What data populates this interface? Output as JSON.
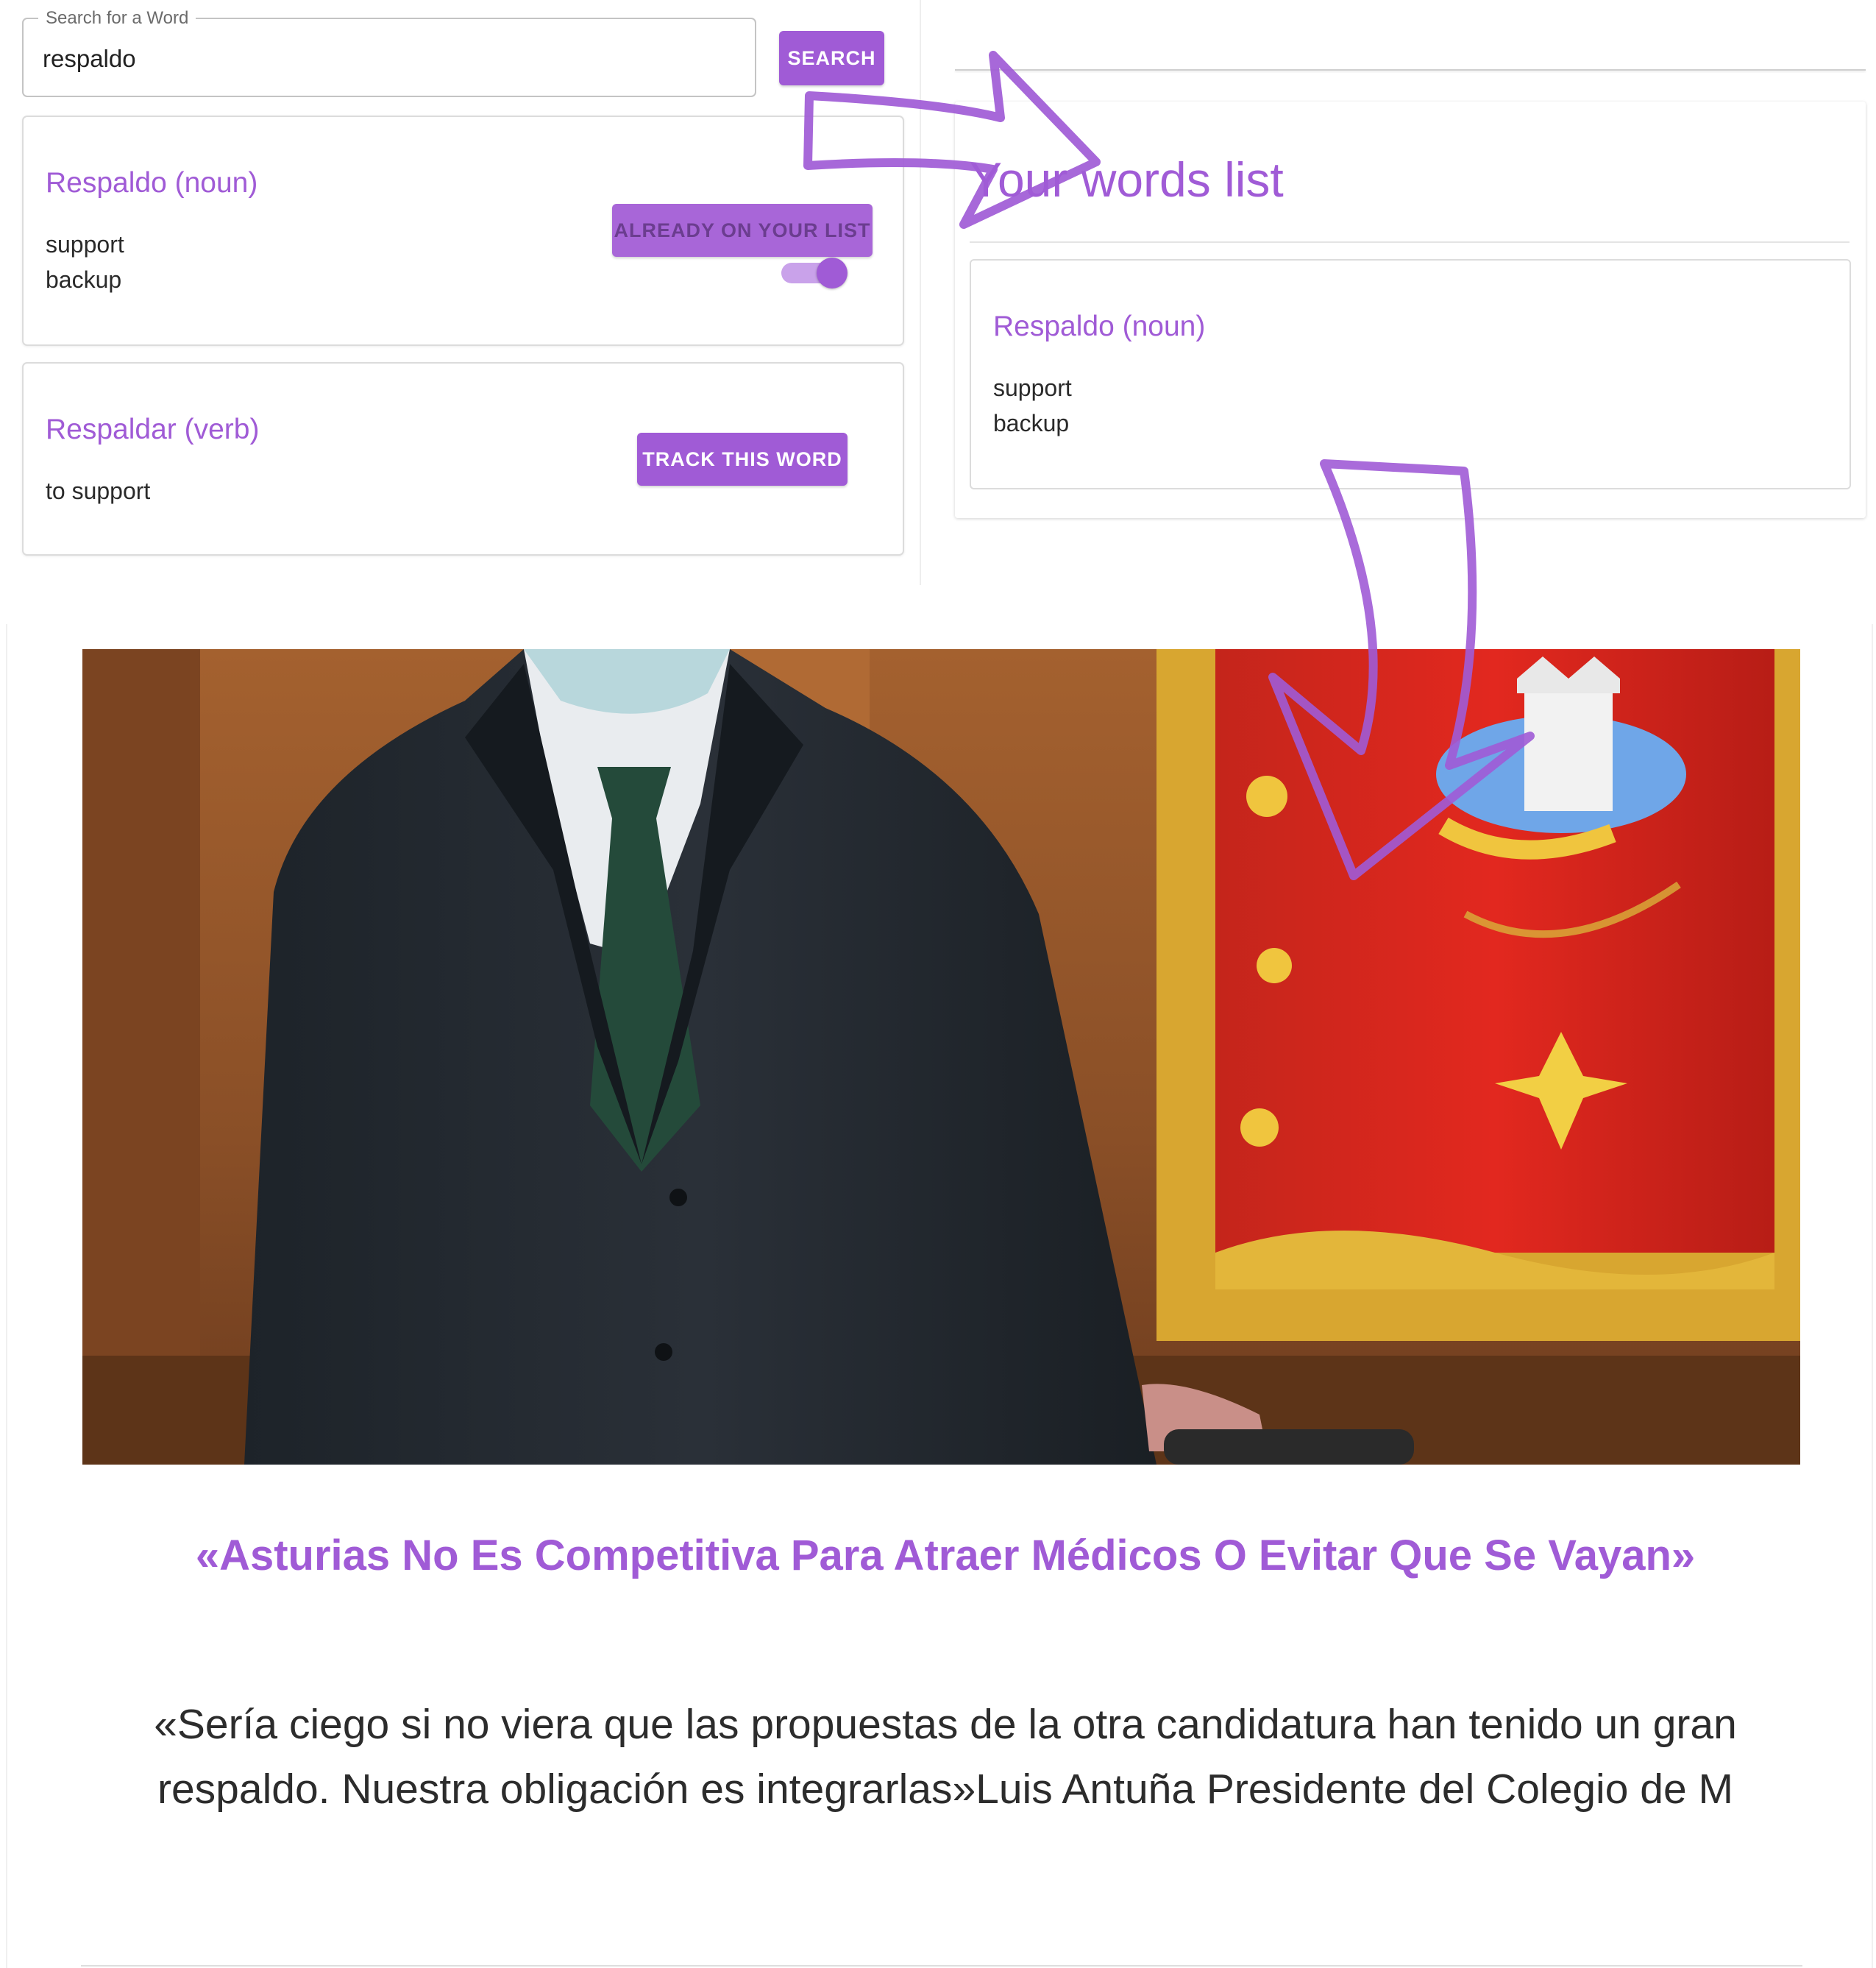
{
  "search": {
    "label": "Search for a Word",
    "value": "respaldo",
    "button_label": "SEARCH"
  },
  "results": [
    {
      "title": "Respaldo (noun)",
      "meanings": [
        "support",
        "backup"
      ],
      "action_label": "ALREADY ON YOUR LIST"
    },
    {
      "title": "Respaldar (verb)",
      "meanings": [
        "to support"
      ],
      "action_label": "TRACK THIS WORD"
    }
  ],
  "words_list": {
    "title": "Your words list",
    "items": [
      {
        "title": "Respaldo (noun)",
        "meanings": [
          "support",
          "backup"
        ],
        "tracked": true
      }
    ]
  },
  "article": {
    "headline": "«Asturias No Es Competitiva Para Atraer Médicos O Evitar Que Se Vayan»",
    "quote": "«Sería ciego si no viera que las propuestas de la otra candidatura han tenido un gran respaldo. Nuestra obligación es integrarlas»Luis Antuña Presidente del Colegio de M"
  },
  "colors": {
    "accent": "#a05bd6",
    "toggle_track": "#c9a2ea",
    "text": "#2a2a2a"
  },
  "icons": [
    "arrow-right-icon",
    "arrow-down-icon",
    "toggle-switch"
  ]
}
